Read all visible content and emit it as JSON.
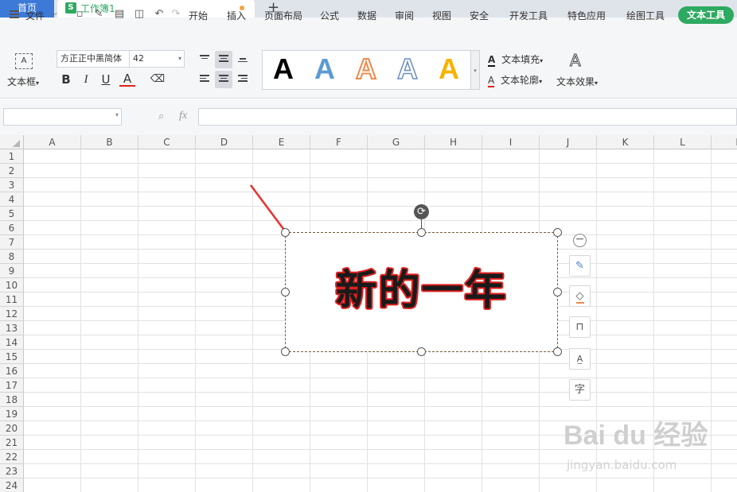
{
  "tabs": {
    "home": "首页",
    "doc_icon": "S",
    "doc_name": "工作簿1",
    "plus": "+"
  },
  "menu": {
    "file": "文件",
    "items": [
      "开始",
      "插入",
      "页面布局",
      "公式",
      "数据",
      "审阅",
      "视图",
      "安全",
      "开发工具",
      "特色应用",
      "绘图工具"
    ],
    "active": "文本工具"
  },
  "ribbon": {
    "textbox_label": "文本框",
    "font_name": "方正正中黑简体",
    "font_size": "42",
    "bold": "B",
    "italic": "I",
    "underline": "U",
    "font_color": "A",
    "eraser": "⌫",
    "sample_letter": "A",
    "text_fill": "文本填充",
    "text_outline": "文本轮廓",
    "text_effect": "文本效果"
  },
  "formula": {
    "fx": "fx",
    "zoom_icon": "magnifier-icon"
  },
  "grid": {
    "columns": [
      "A",
      "B",
      "C",
      "D",
      "E",
      "F",
      "G",
      "H",
      "I",
      "J",
      "K",
      "L",
      "M"
    ],
    "rows": [
      "1",
      "2",
      "3",
      "4",
      "5",
      "6",
      "7",
      "8",
      "9",
      "10",
      "11",
      "12",
      "13",
      "14",
      "15",
      "16",
      "17",
      "18",
      "19",
      "20",
      "21",
      "22",
      "23",
      "24"
    ]
  },
  "textbox": {
    "content": "新的一年"
  },
  "side_tools": [
    "brush-icon",
    "fill-icon",
    "outline-icon",
    "textbox-icon",
    "wrap-icon"
  ],
  "watermark": {
    "main": "Bai du 经验",
    "sub": "jingyan.baidu.com"
  },
  "colors": {
    "accent": "#2ea961",
    "home_tab": "#3d7ad8",
    "text_outline": "#e02020"
  }
}
